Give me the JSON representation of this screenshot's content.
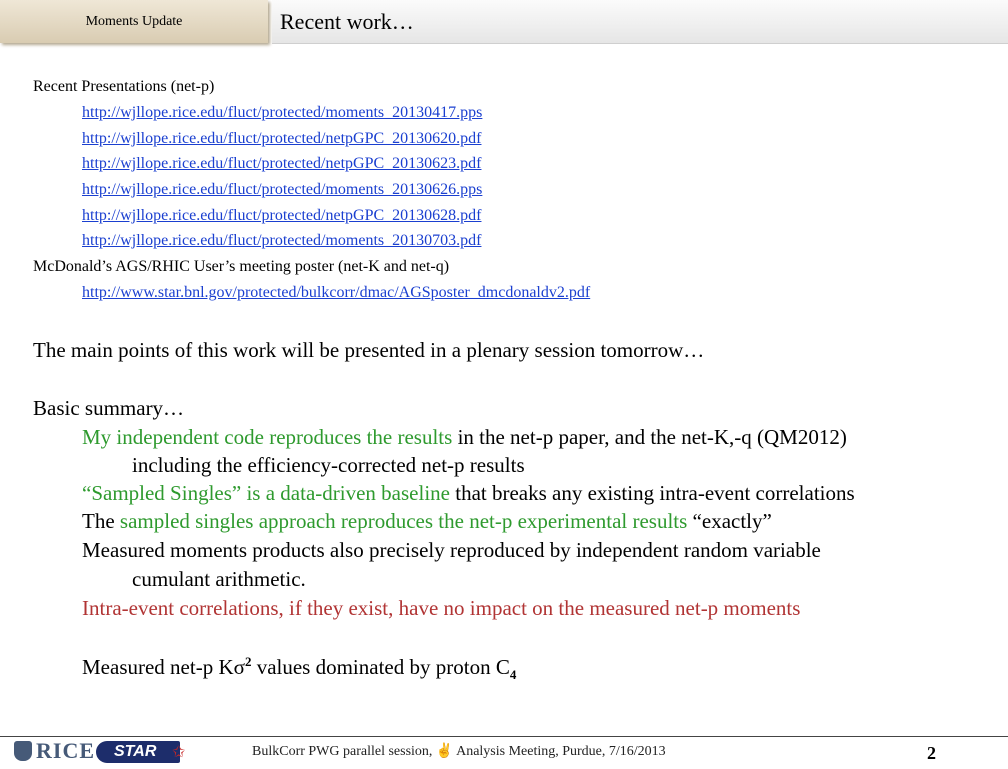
{
  "header": {
    "tab_label": "Moments Update",
    "title": "Recent work…"
  },
  "presentations": {
    "heading": "Recent Presentations (net-p)",
    "links": [
      "http://wjllope.rice.edu/fluct/protected/moments_20130417.pps",
      "http://wjllope.rice.edu/fluct/protected/netpGPC_20130620.pdf",
      "http://wjllope.rice.edu/fluct/protected/netpGPC_20130623.pdf",
      "http://wjllope.rice.edu/fluct/protected/moments_20130626.pps",
      "http://wjllope.rice.edu/fluct/protected/netpGPC_20130628.pdf",
      "http://wjllope.rice.edu/fluct/protected/moments_20130703.pdf"
    ],
    "poster_heading": "McDonald’s AGS/RHIC User’s meeting poster (net-K and net-q)",
    "poster_link": "http://www.star.bnl.gov/protected/bulkcorr/dmac/AGSposter_dmcdonaldv2.pdf"
  },
  "body": {
    "main_points": "The main points of this work will be presented in a plenary session tomorrow…",
    "summary_heading": "Basic summary…",
    "b1_green": "My independent code reproduces the results",
    "b1_rest": " in the net-p paper, and the net-K,-q (QM2012)",
    "b1_cont": "including the efficiency-corrected net-p results",
    "b2_green": "“Sampled Singles” is a data-driven baseline",
    "b2_rest": " that breaks any existing intra-event correlations",
    "b3_pre": "The ",
    "b3_green": "sampled singles approach reproduces the net-p experimental results",
    "b3_rest": " “exactly”",
    "b4": "Measured moments products also precisely reproduced by independent random variable",
    "b4_cont": "cumulant arithmetic.",
    "b5_red": "Intra-event correlations, if they exist, have no impact on the measured net-p moments",
    "b6_pre": "Measured net-p K",
    "b6_sigma": "σ",
    "b6_exp": "2",
    "b6_post": "  values dominated by proton C",
    "b6_sub": "4"
  },
  "footer": {
    "rice_logo": "RICE",
    "star_logo": "STAR",
    "text": "BulkCorr PWG parallel session,  ✌  Analysis Meeting,  Purdue,  7/16/2013",
    "page_number": "2"
  },
  "colors": {
    "green": "#2e9a2e",
    "red": "#b13434",
    "link": "#1a3fd0"
  }
}
